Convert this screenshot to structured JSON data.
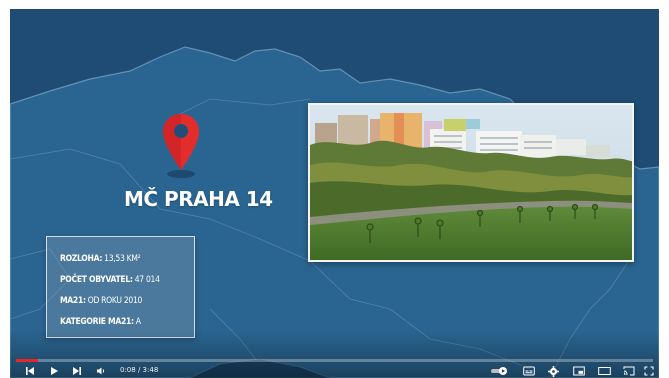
{
  "player": {
    "current_time": "0:08",
    "time_separator": " / ",
    "duration": "3:48",
    "progress_fraction": 0.035,
    "accent_color": "#e8262a"
  },
  "video": {
    "title": "MČ PRAHA 14",
    "info": [
      {
        "key": "ROZLOHA:",
        "value": "13,53 KM²"
      },
      {
        "key": "POČET OBYVATEL:",
        "value": "47 014"
      },
      {
        "key": "MA21:",
        "value": "OD ROKU 2010"
      },
      {
        "key": "KATEGORIE MA21:",
        "value": "A"
      }
    ],
    "pin_color": "#e32d2d",
    "map_color": "#2a6591",
    "background_color": "#1f4f78"
  },
  "controls": {
    "icons": [
      "previous-icon",
      "play-icon",
      "next-icon",
      "volume-icon",
      "autoplay-toggle-icon",
      "subtitles-icon",
      "settings-icon",
      "miniplayer-icon",
      "theater-mode-icon",
      "cast-icon",
      "fullscreen-icon"
    ]
  }
}
